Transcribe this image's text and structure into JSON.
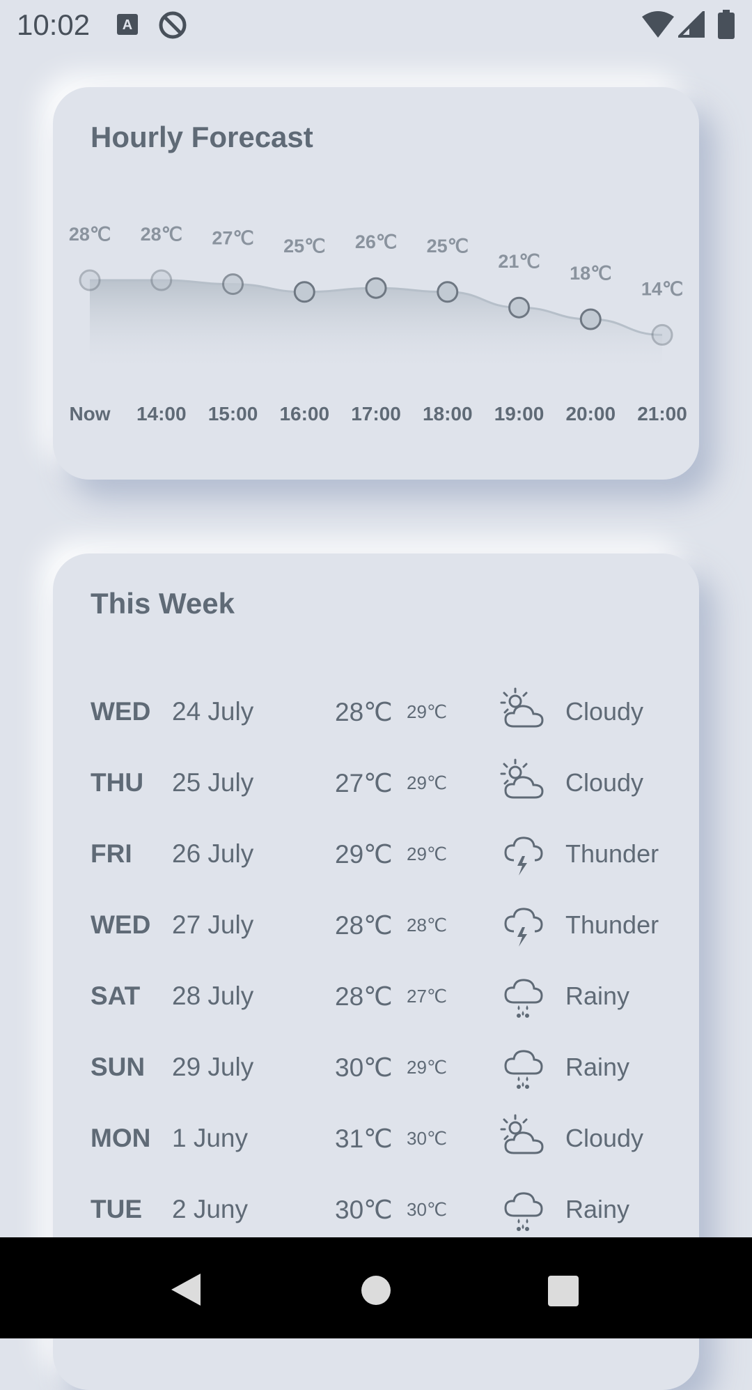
{
  "status_bar": {
    "time": "10:02",
    "left_icons": [
      "keyboard-a-icon",
      "no-disturb-icon"
    ],
    "right_icons": [
      "wifi-icon",
      "cell-signal-icon",
      "battery-icon"
    ]
  },
  "hourly": {
    "title": "Hourly Forecast",
    "items": [
      {
        "time": "Now",
        "temp_label": "28℃",
        "temp": 28
      },
      {
        "time": "14:00",
        "temp_label": "28℃",
        "temp": 28
      },
      {
        "time": "15:00",
        "temp_label": "27℃",
        "temp": 27
      },
      {
        "time": "16:00",
        "temp_label": "25℃",
        "temp": 25
      },
      {
        "time": "17:00",
        "temp_label": "26℃",
        "temp": 26
      },
      {
        "time": "18:00",
        "temp_label": "25℃",
        "temp": 25
      },
      {
        "time": "19:00",
        "temp_label": "21℃",
        "temp": 21
      },
      {
        "time": "20:00",
        "temp_label": "18℃",
        "temp": 18
      },
      {
        "time": "21:00",
        "temp_label": "14℃",
        "temp": 14
      }
    ]
  },
  "week": {
    "title": "This Week",
    "rows": [
      {
        "day": "WED",
        "date": "24 July",
        "high": "28℃",
        "low": "29℃",
        "icon": "cloudy-icon",
        "condition": "Cloudy"
      },
      {
        "day": "THU",
        "date": "25 July",
        "high": "27℃",
        "low": "29℃",
        "icon": "cloudy-icon",
        "condition": "Cloudy"
      },
      {
        "day": "FRI",
        "date": "26 July",
        "high": "29℃",
        "low": "29℃",
        "icon": "thunder-icon",
        "condition": "Thunder"
      },
      {
        "day": "WED",
        "date": "27 July",
        "high": "28℃",
        "low": "28℃",
        "icon": "thunder-icon",
        "condition": "Thunder"
      },
      {
        "day": "SAT",
        "date": "28 July",
        "high": "28℃",
        "low": "27℃",
        "icon": "rainy-icon",
        "condition": "Rainy"
      },
      {
        "day": "SUN",
        "date": "29 July",
        "high": "30℃",
        "low": "29℃",
        "icon": "rainy-icon",
        "condition": "Rainy"
      },
      {
        "day": "MON",
        "date": "1 Juny",
        "high": "31℃",
        "low": "30℃",
        "icon": "cloudy-icon",
        "condition": "Cloudy"
      },
      {
        "day": "TUE",
        "date": "2 Juny",
        "high": "30℃",
        "low": "30℃",
        "icon": "rainy-icon",
        "condition": "Rainy"
      }
    ]
  },
  "nav_bar": {
    "buttons": [
      "back-button",
      "home-button",
      "recents-button"
    ]
  },
  "colors": {
    "background": "#dfe3eb",
    "text": "#5f6a76",
    "nav_bar": "#000000"
  }
}
